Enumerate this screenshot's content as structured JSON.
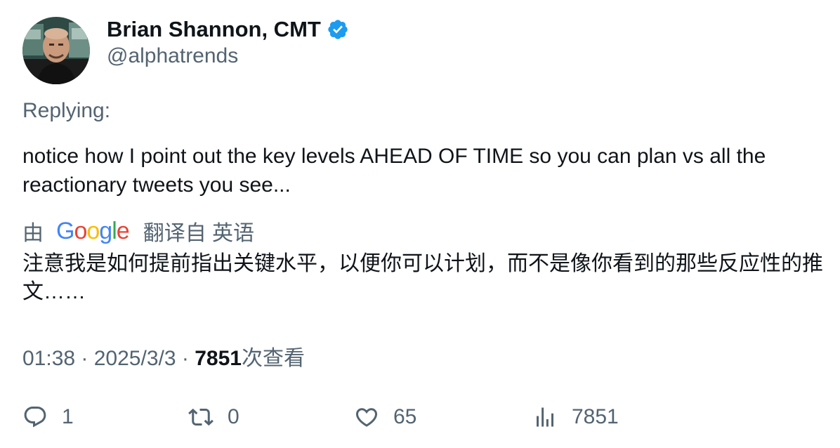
{
  "author": {
    "display_name": "Brian Shannon, CMT",
    "handle": "@alphatrends",
    "verified": true,
    "verified_color": "#1d9bf0"
  },
  "tweet": {
    "replying_label": "Replying:",
    "text": "notice how I point out the key levels AHEAD OF TIME so you can plan vs all the reactionary tweets you see...",
    "translation_prefix": "由",
    "translation_provider": "Google",
    "translation_suffix": "翻译自 英语",
    "translated_text": "注意我是如何提前指出关键水平，以便你可以计划，而不是像你看到的那些反应性的推文……",
    "time": "01:38",
    "date": "2025/3/3",
    "views_count": "7851",
    "views_label": "次查看"
  },
  "actions": {
    "reply_count": "1",
    "retweet_count": "0",
    "like_count": "65",
    "views_count": "7851"
  },
  "icons": {
    "reply": "reply-icon",
    "retweet": "retweet-icon",
    "like": "heart-icon",
    "views": "views-icon",
    "verified": "verified-badge-icon"
  },
  "colors": {
    "text_primary": "#0f1419",
    "text_secondary": "#536471",
    "verified_blue": "#1d9bf0"
  }
}
